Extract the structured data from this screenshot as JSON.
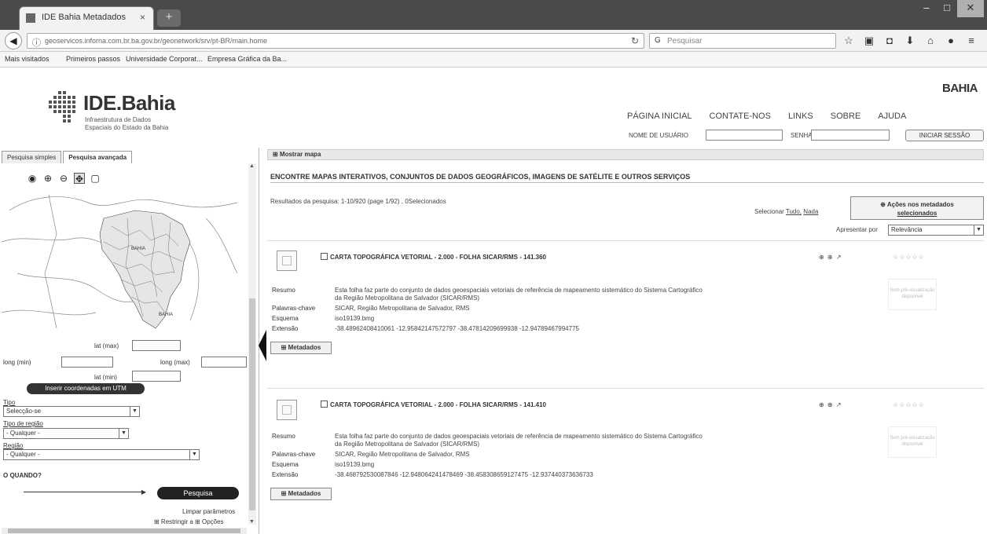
{
  "browser": {
    "tab_title": "IDE Bahia Metadados",
    "tab_close": "×",
    "new_tab": "+",
    "url": "geoservicos.inforna.com.br.ba.gov.br/geonetwork/srv/pt-BR/main.home",
    "search_placeholder": "Pesquisar",
    "window_controls": [
      "–",
      "□",
      "✕"
    ],
    "bookmarks": [
      "Mais visitados",
      "Primeiros passos",
      "Universidade Corporat...",
      "Empresa Gráfica da Ba..."
    ]
  },
  "header": {
    "logo_title": "IDE.Bahia",
    "logo_sub1": "Infraestrutura de Dados",
    "logo_sub2": "Espaciais do Estado da Bahia",
    "brand": "BAHIA",
    "nav": [
      "PÁGINA INICIAL",
      "CONTATE-NOS",
      "LINKS",
      "SOBRE",
      "AJUDA"
    ],
    "username_label": "NOME DE USUÁRIO",
    "password_label": "SENHA",
    "login_button": "INICIAR SESSÃO"
  },
  "left": {
    "tabs": [
      "Pesquisa simples",
      "Pesquisa avançada"
    ],
    "map_labels": [
      "BAHIA",
      "BAHIA"
    ],
    "lat_max_label": "lat (max)",
    "long_min_label": "long (min)",
    "long_max_label": "long (max)",
    "lat_min_label": "lat (min)",
    "utm_button": "Inserir coordenadas em UTM",
    "type_label": "Tipo",
    "type_value": "Selecção-se",
    "region_type_label": "Tipo de região",
    "region_type_value": "- Qualquer -",
    "region_label": "Região",
    "region_value": "- Qualquer -",
    "when_label": "O QUANDO?",
    "search_button": "Pesquisa",
    "clear_link": "Limpar parâmetros",
    "restrict_link": "⊞ Restringir a  ⊞ Opções"
  },
  "main": {
    "map_toggle": "⊞ Mostrar mapa",
    "headline": "ENCONTRE MAPAS INTERATIVOS, CONJUNTOS DE DADOS GEOGRÁFICOS, IMAGENS DE SATÉLITE E OUTROS SERVIÇOS",
    "results_info": "Resultados da pesquisa:  1-10/920  (page 1/92) ,  0Selecionados",
    "select_prefix": "Selecionar",
    "select_all": "Tudo,",
    "select_none": "Nada",
    "action_line1": "⊕ Ações nos metadados",
    "action_line2": "selecionados",
    "sort_label": "Apresentar por",
    "sort_value": "Relevância",
    "results": [
      {
        "title": "CARTA TOPOGRÁFICA VETORIAL - 2.000 - FOLHA SICAR/RMS - 141.360",
        "summary_label": "Resumo",
        "summary_1": "Esta folha faz parte do conjunto de dados geoespaciais vetoriais de referência de mapeamento sistemático do Sistema Cartográfico",
        "summary_2": "da Região Metropolitana de Salvador (SICAR/RMS)",
        "keywords_label": "Palavras-chave",
        "keywords": "SICAR, Região Metropolitana de Salvador, RMS",
        "schema_label": "Esquema",
        "schema": "iso19139.bmg",
        "extent_label": "Extensão",
        "extent": "-38.48962408410061 -12.95842147572797 -38.47814209699938 -12.94789467994775",
        "metadata_button": "⊞ Metadados",
        "icons": "⊕ ⊕ ↗",
        "stars": "☆☆☆☆☆",
        "no_thumb": "Sem pré-visualização disponível"
      },
      {
        "title": "CARTA TOPOGRÁFICA VETORIAL - 2.000 - FOLHA SICAR/RMS - 141.410",
        "summary_label": "Resumo",
        "summary_1": "Esta folha faz parte do conjunto de dados geoespaciais vetoriais de referência de mapeamento sistemático do Sistema Cartográfico",
        "summary_2": "da Região Metropolitana de Salvador (SICAR/RMS)",
        "keywords_label": "Palavras-chave",
        "keywords": "SICAR, Região Metropolitana de Salvador, RMS",
        "schema_label": "Esquema",
        "schema": "iso19139.bmg",
        "extent_label": "Extensão",
        "extent": "-38.468792530087846 -12.948064241478469 -38.458308659127475 -12.937440373636733",
        "metadata_button": "⊞ Metadados",
        "icons": "⊕ ⊕ ↗",
        "stars": "☆☆☆☆☆",
        "no_thumb": "Sem pré-visualização disponível"
      }
    ]
  }
}
